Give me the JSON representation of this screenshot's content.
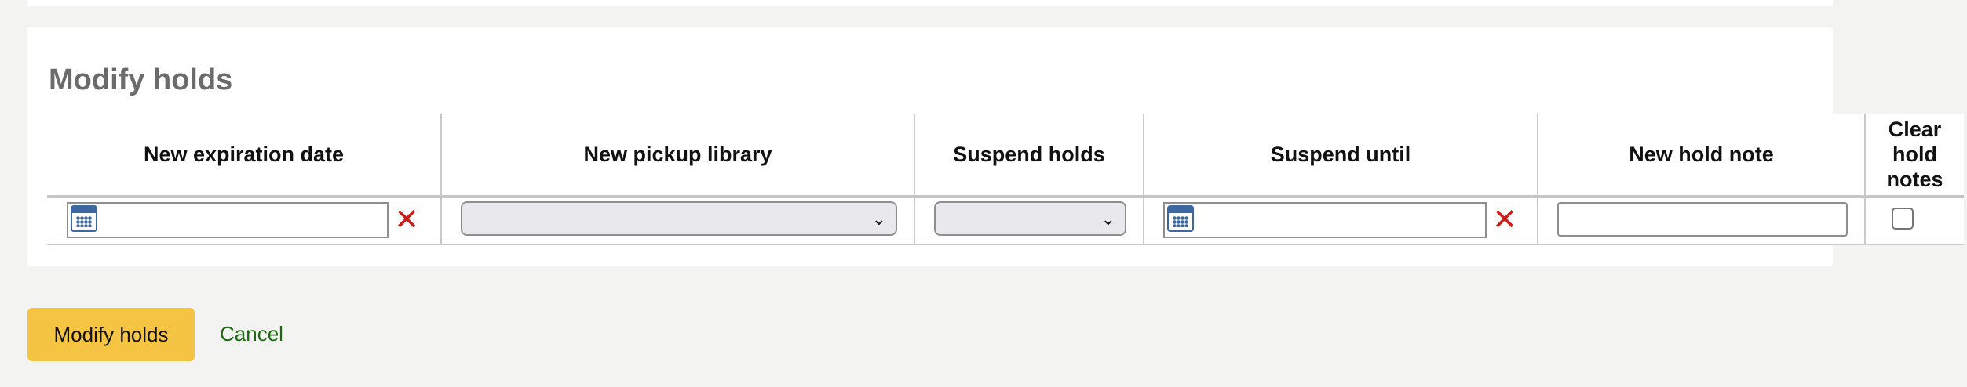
{
  "section": {
    "title": "Modify holds"
  },
  "table": {
    "headers": [
      "New expiration date",
      "New pickup library",
      "Suspend holds",
      "Suspend until",
      "New hold note",
      "Clear hold notes"
    ],
    "row": {
      "expiration_date": {
        "value": ""
      },
      "pickup_library": {
        "selected": ""
      },
      "suspend_holds": {
        "selected": ""
      },
      "suspend_until": {
        "value": ""
      },
      "hold_note": {
        "value": ""
      },
      "clear_hold_notes": {
        "checked": false
      }
    },
    "clear_glyph": "✕",
    "chevron_glyph": "⌄"
  },
  "actions": {
    "submit_label": "Modify holds",
    "cancel_label": "Cancel"
  },
  "icons": {
    "calendar": "calendar-icon",
    "clear": "clear-icon",
    "dropdown": "chevron-down-icon"
  },
  "colors": {
    "primary_button": "#f5c443",
    "cancel_link": "#1d6a12",
    "clear_icon": "#cc1f1a",
    "calendar_icon": "#3c67a0",
    "page_background": "#f3f4f2"
  }
}
